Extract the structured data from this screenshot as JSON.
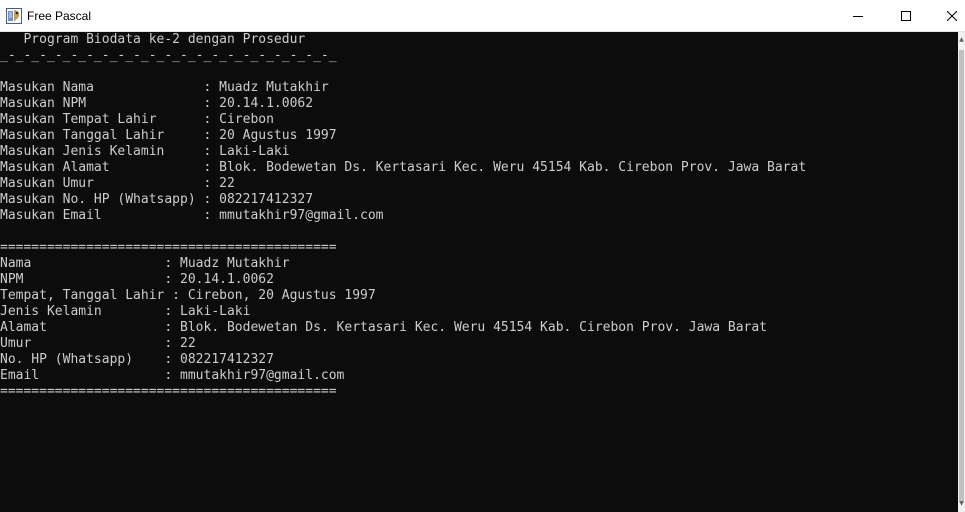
{
  "window": {
    "title": "Free Pascal",
    "icon": "free-pascal-app-icon",
    "controls": {
      "minimize_icon": "minimize-icon",
      "maximize_icon": "maximize-icon",
      "close_icon": "close-icon"
    }
  },
  "colors": {
    "console_bg": "#0c0c0c",
    "console_text": "#cccccc",
    "titlebar_bg": "#ffffff"
  },
  "console": {
    "lines": [
      "   Program Biodata ke-2 dengan Prosedur",
      "_-_-_-_-_-_-_-_-_-_-_-_-_-_-_-_-_-_-_-_-_-_",
      "",
      "Masukan Nama              : Muadz Mutakhir",
      "Masukan NPM               : 20.14.1.0062",
      "Masukan Tempat Lahir      : Cirebon",
      "Masukan Tanggal Lahir     : 20 Agustus 1997",
      "Masukan Jenis Kelamin     : Laki-Laki",
      "Masukan Alamat            : Blok. Bodewetan Ds. Kertasari Kec. Weru 45154 Kab. Cirebon Prov. Jawa Barat",
      "Masukan Umur              : 22",
      "Masukan No. HP (Whatsapp) : 082217412327",
      "Masukan Email             : mmutakhir97@gmail.com",
      "",
      "===========================================",
      "Nama                 : Muadz Mutakhir",
      "NPM                  : 20.14.1.0062",
      "Tempat, Tanggal Lahir : Cirebon, 20 Agustus 1997",
      "Jenis Kelamin        : Laki-Laki",
      "Alamat               : Blok. Bodewetan Ds. Kertasari Kec. Weru 45154 Kab. Cirebon Prov. Jawa Barat",
      "Umur                 : 22",
      "No. HP (Whatsapp)    : 082217412327",
      "Email                : mmutakhir97@gmail.com",
      "==========================================="
    ]
  }
}
